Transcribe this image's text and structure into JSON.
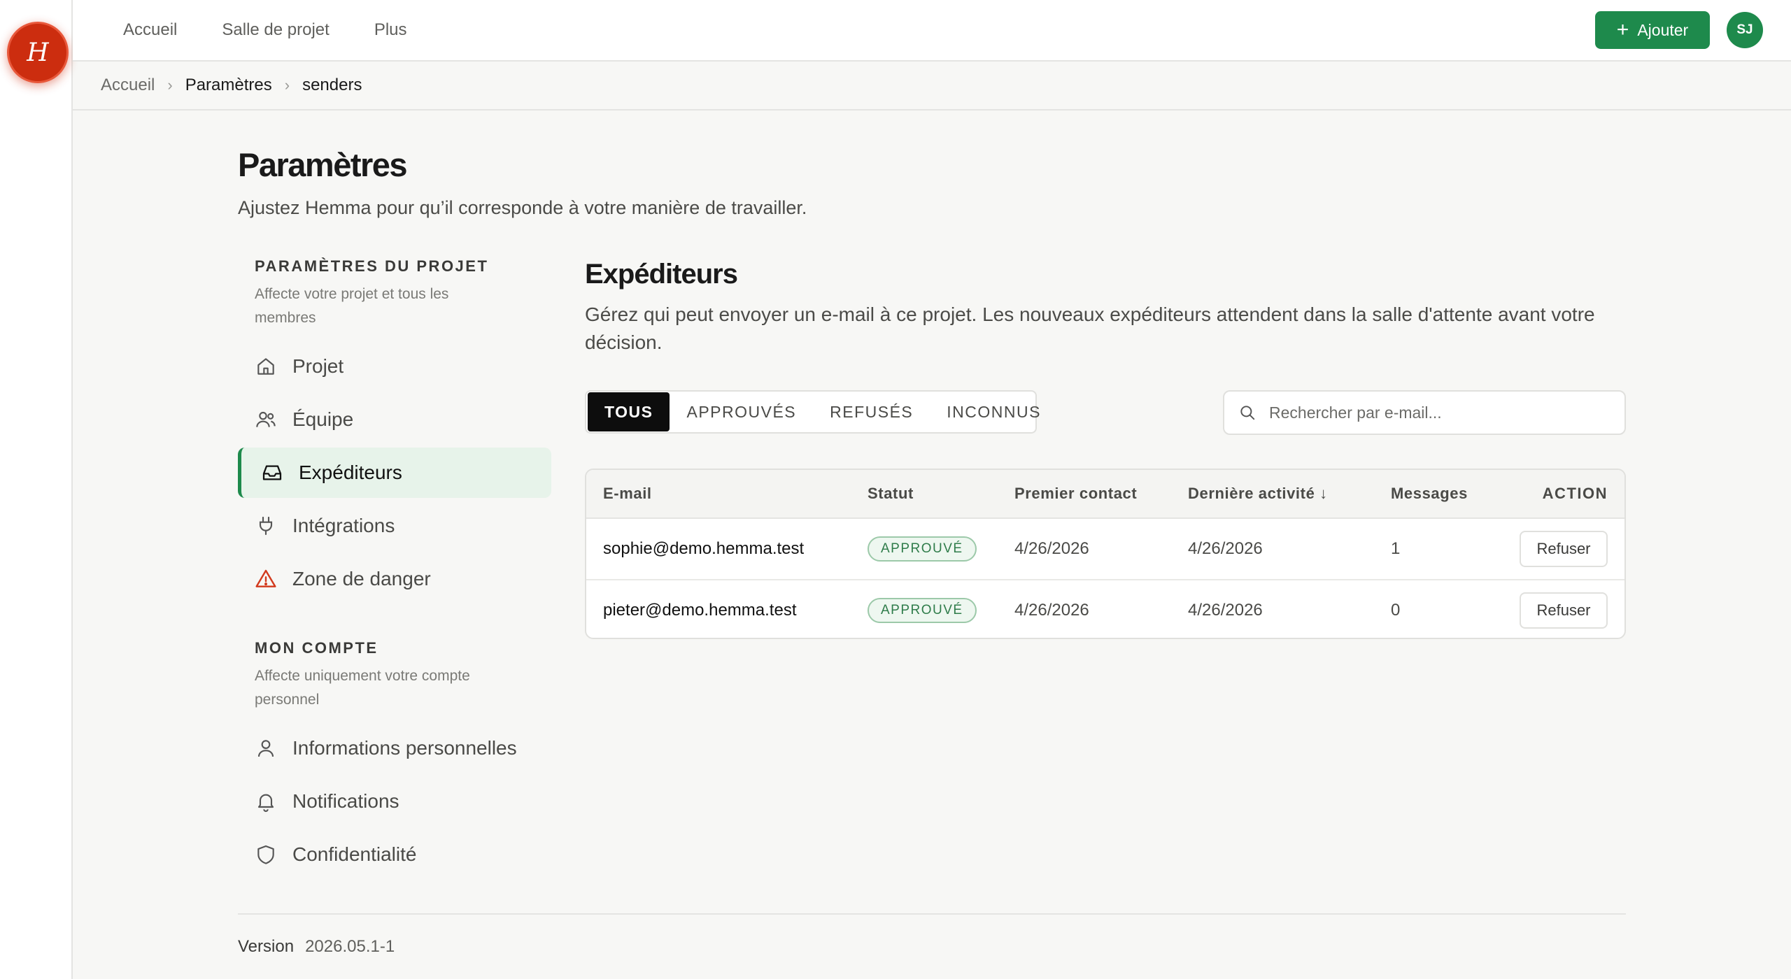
{
  "brand": {
    "logo_letter": "H",
    "accent": "#1e8a4c",
    "logo_color": "#cc2d0f"
  },
  "topnav": {
    "items": [
      "Accueil",
      "Salle de projet",
      "Plus"
    ]
  },
  "header": {
    "add_label": "Ajouter",
    "avatar_initials": "SJ"
  },
  "breadcrumb": {
    "items": [
      "Accueil",
      "Paramètres",
      "senders"
    ]
  },
  "page": {
    "title": "Paramètres",
    "subtitle": "Ajustez Hemma pour qu’il corresponde à votre manière de travailler."
  },
  "sidebar": {
    "project_section": {
      "title": "PARAMÈTRES DU PROJET",
      "description": "Affecte votre projet et tous les membres",
      "items": [
        {
          "label": "Projet",
          "icon": "home-icon"
        },
        {
          "label": "Équipe",
          "icon": "users-icon"
        },
        {
          "label": "Expéditeurs",
          "icon": "inbox-icon",
          "active": true
        },
        {
          "label": "Intégrations",
          "icon": "plug-icon"
        },
        {
          "label": "Zone de danger",
          "icon": "warning-icon"
        }
      ]
    },
    "account_section": {
      "title": "MON COMPTE",
      "description": "Affecte uniquement votre compte personnel",
      "items": [
        {
          "label": "Informations personnelles",
          "icon": "user-icon"
        },
        {
          "label": "Notifications",
          "icon": "bell-icon"
        },
        {
          "label": "Confidentialité",
          "icon": "shield-icon"
        }
      ]
    }
  },
  "content": {
    "title": "Expéditeurs",
    "description": "Gérez qui peut envoyer un e-mail à ce projet. Les nouveaux expéditeurs attendent dans la salle d'attente avant votre décision.",
    "tabs": [
      "TOUS",
      "APPROUVÉS",
      "REFUSÉS",
      "INCONNUS"
    ],
    "active_tab": "TOUS",
    "search_placeholder": "Rechercher par e-mail...",
    "table": {
      "columns": [
        "E-mail",
        "Statut",
        "Premier contact",
        "Dernière activité ↓",
        "Messages",
        "ACTION"
      ],
      "rows": [
        {
          "email": "sophie@demo.hemma.test",
          "status": "APPROUVÉ",
          "first_contact": "4/26/2026",
          "last_activity": "4/26/2026",
          "messages": "1",
          "action": "Refuser"
        },
        {
          "email": "pieter@demo.hemma.test",
          "status": "APPROUVÉ",
          "first_contact": "4/26/2026",
          "last_activity": "4/26/2026",
          "messages": "0",
          "action": "Refuser"
        }
      ]
    }
  },
  "footer": {
    "version_label": "Version",
    "version": "2026.05.1-1"
  }
}
